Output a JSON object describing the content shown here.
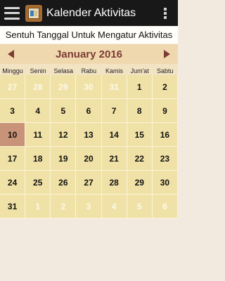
{
  "appbar": {
    "title": "Kalender Aktivitas",
    "menu_icon": "hamburger-menu-icon",
    "app_icon": "calendar-app-icon",
    "overflow_icon": "overflow-menu-icon"
  },
  "instruction": "Sentuh Tanggal Untuk Mengatur Aktivitas",
  "calendar": {
    "month_label": "January 2016",
    "weekdays": [
      "Minggu",
      "Senin",
      "Selasa",
      "Rabu",
      "Kamis",
      "Jum'at",
      "Sabtu"
    ],
    "today": "10",
    "days": [
      {
        "label": "27",
        "current": false
      },
      {
        "label": "28",
        "current": false
      },
      {
        "label": "29",
        "current": false
      },
      {
        "label": "30",
        "current": false
      },
      {
        "label": "31",
        "current": false
      },
      {
        "label": "1",
        "current": true
      },
      {
        "label": "2",
        "current": true
      },
      {
        "label": "3",
        "current": true
      },
      {
        "label": "4",
        "current": true
      },
      {
        "label": "5",
        "current": true
      },
      {
        "label": "6",
        "current": true
      },
      {
        "label": "7",
        "current": true
      },
      {
        "label": "8",
        "current": true
      },
      {
        "label": "9",
        "current": true
      },
      {
        "label": "10",
        "current": true
      },
      {
        "label": "11",
        "current": true
      },
      {
        "label": "12",
        "current": true
      },
      {
        "label": "13",
        "current": true
      },
      {
        "label": "14",
        "current": true
      },
      {
        "label": "15",
        "current": true
      },
      {
        "label": "16",
        "current": true
      },
      {
        "label": "17",
        "current": true
      },
      {
        "label": "18",
        "current": true
      },
      {
        "label": "19",
        "current": true
      },
      {
        "label": "20",
        "current": true
      },
      {
        "label": "21",
        "current": true
      },
      {
        "label": "22",
        "current": true
      },
      {
        "label": "23",
        "current": true
      },
      {
        "label": "24",
        "current": true
      },
      {
        "label": "25",
        "current": true
      },
      {
        "label": "26",
        "current": true
      },
      {
        "label": "27",
        "current": true
      },
      {
        "label": "28",
        "current": true
      },
      {
        "label": "29",
        "current": true
      },
      {
        "label": "30",
        "current": true
      },
      {
        "label": "31",
        "current": true
      },
      {
        "label": "1",
        "current": false
      },
      {
        "label": "2",
        "current": false
      },
      {
        "label": "3",
        "current": false
      },
      {
        "label": "4",
        "current": false
      },
      {
        "label": "5",
        "current": false
      },
      {
        "label": "6",
        "current": false
      }
    ]
  },
  "colors": {
    "appbar": "#181818",
    "month_text": "#7b3c35",
    "cell": "#f0e2a6",
    "today_cell": "#c99379",
    "background": "#f3eadf"
  }
}
